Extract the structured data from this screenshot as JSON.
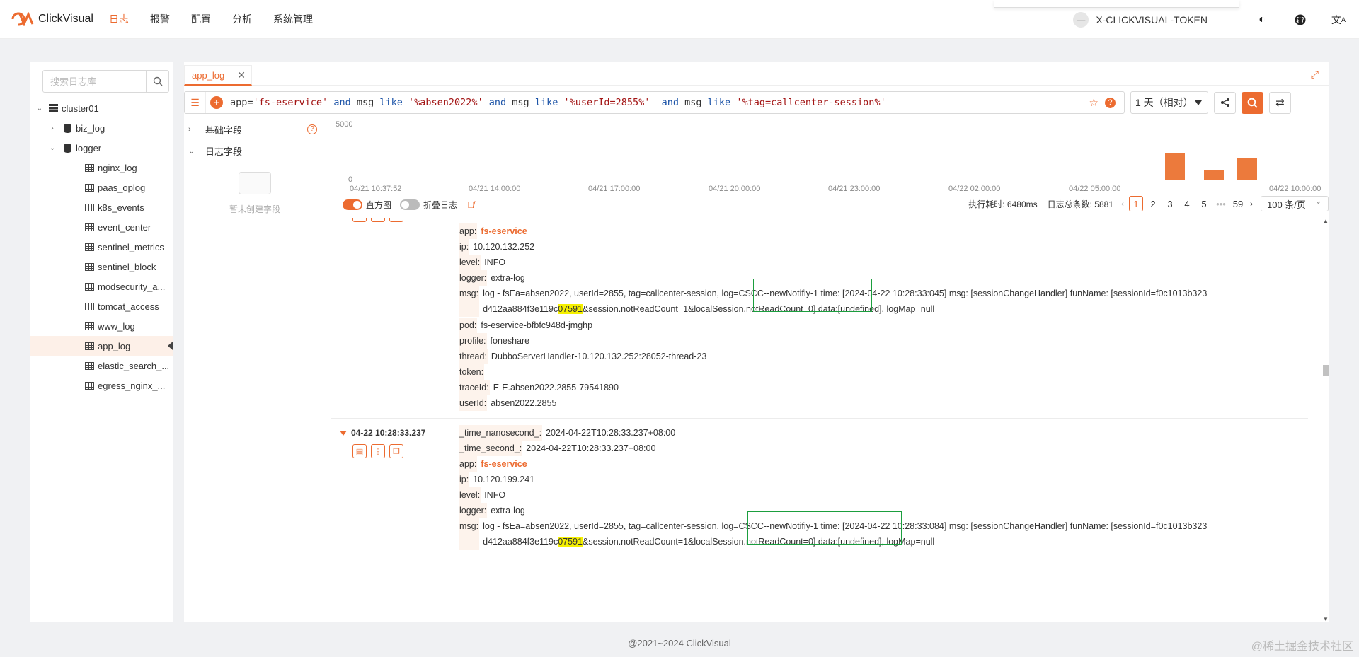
{
  "app": {
    "name": "ClickVisual"
  },
  "nav": [
    {
      "label": "日志",
      "active": true
    },
    {
      "label": "报警",
      "active": false
    },
    {
      "label": "配置",
      "active": false
    },
    {
      "label": "分析",
      "active": false
    },
    {
      "label": "系统管理",
      "active": false
    }
  ],
  "topright": {
    "token": "X-CLICKVISUAL-TOKEN",
    "icons": [
      "theme-icon",
      "github-icon",
      "translate-icon"
    ]
  },
  "sidebar": {
    "search_placeholder": "搜索日志库",
    "cluster": "cluster01",
    "databases": [
      {
        "name": "biz_log",
        "expanded": false
      },
      {
        "name": "logger",
        "expanded": true
      }
    ],
    "tables": [
      "nginx_log",
      "paas_oplog",
      "k8s_events",
      "event_center",
      "sentinel_metrics",
      "sentinel_block",
      "modsecurity_a...",
      "tomcat_access",
      "www_log",
      "app_log",
      "elastic_search_...",
      "egress_nginx_..."
    ],
    "selected_table": "app_log"
  },
  "tab": {
    "label": "app_log"
  },
  "query": {
    "time_range": "1 天（相对）",
    "parts": [
      {
        "t": "app=",
        "c": ""
      },
      {
        "t": "'fs-eservice'",
        "c": "s"
      },
      {
        "t": " and ",
        "c": "k"
      },
      {
        "t": "msg ",
        "c": ""
      },
      {
        "t": "like ",
        "c": "k"
      },
      {
        "t": "'%absen2022%'",
        "c": "s"
      },
      {
        "t": " and ",
        "c": "k"
      },
      {
        "t": "msg ",
        "c": ""
      },
      {
        "t": "like ",
        "c": "k"
      },
      {
        "t": "'%userId=2855%'",
        "c": "s"
      },
      {
        "t": "  and ",
        "c": "k"
      },
      {
        "t": "msg ",
        "c": ""
      },
      {
        "t": "like ",
        "c": "k"
      },
      {
        "t": "'%tag=callcenter-session%'",
        "c": "s"
      }
    ]
  },
  "fields": {
    "basic_label": "基础字段",
    "log_label": "日志字段",
    "empty_text": "暂未创建字段"
  },
  "histogram": {
    "y_ticks": [
      "5000",
      "0"
    ],
    "x_ticks": [
      "04/21 10:37:52",
      "04/21 14:00:00",
      "04/21 17:00:00",
      "04/21 20:00:00",
      "04/21 23:00:00",
      "04/22 02:00:00",
      "04/22 05:00:00",
      "04/22 10:00:00"
    ],
    "bars": [
      {
        "level": 0.48
      },
      {
        "level": 0.16
      },
      {
        "level": 0.38
      }
    ]
  },
  "toolbar": {
    "histogram_label": "直方图",
    "histogram_on": true,
    "fold_label": "折叠日志",
    "fold_on": false,
    "exec_time": "执行耗时: 6480ms",
    "total": "日志总条数: 5881",
    "pages": [
      "1",
      "2",
      "3",
      "4",
      "5",
      "•••",
      "59"
    ],
    "current_page": "1",
    "page_size": "100 条/页"
  },
  "logs": [
    {
      "fields": [
        {
          "k": "app:",
          "v": "fs-eservice",
          "orange": true
        },
        {
          "k": "ip:",
          "v": "10.120.132.252"
        },
        {
          "k": "level:",
          "v": "INFO"
        },
        {
          "k": "logger:",
          "v": "extra-log"
        },
        {
          "k": "msg:",
          "msg1": "log - fsEa=absen2022, userId=2855, tag=callcenter-session, log=CSCC--newNotifiy-1 time: [2024-04-22 10:28:33:045] msg: [sessionChangeHandler] funName: [sessionId=f0c1013b323",
          "msg2a": "d412aa884f3e119c",
          "msg2hl": "07591",
          "msg2b": "&session.notReadCount=1&localSession.notReadCount=0] data:[undefined], logMap=null"
        },
        {
          "k": "pod:",
          "v": "fs-eservice-bfbfc948d-jmghp"
        },
        {
          "k": "profile:",
          "v": "foneshare"
        },
        {
          "k": "thread:",
          "v": "DubboServerHandler-10.120.132.252:28052-thread-23"
        },
        {
          "k": "token:",
          "v": ""
        },
        {
          "k": "traceId:",
          "v": "E-E.absen2022.2855-79541890"
        },
        {
          "k": "userId:",
          "v": "absen2022.2855"
        }
      ]
    },
    {
      "time": "04-22 10:28:33.237",
      "fields": [
        {
          "k": "_time_nanosecond_:",
          "v": "2024-04-22T10:28:33.237+08:00"
        },
        {
          "k": "_time_second_:",
          "v": "2024-04-22T10:28:33.237+08:00"
        },
        {
          "k": "app:",
          "v": "fs-eservice",
          "orange": true
        },
        {
          "k": "ip:",
          "v": "10.120.199.241"
        },
        {
          "k": "level:",
          "v": "INFO"
        },
        {
          "k": "logger:",
          "v": "extra-log"
        },
        {
          "k": "msg:",
          "msg1": "log - fsEa=absen2022, userId=2855, tag=callcenter-session, log=CSCC--newNotifiy-1 time: [2024-04-22 10:28:33:084] msg: [sessionChangeHandler] funName: [sessionId=f0c1013b323",
          "msg2a": "d412aa884f3e119c",
          "msg2hl": "07591",
          "msg2b": "&session.notReadCount=1&localSession.notReadCount=0] data:[undefined], logMap=null"
        }
      ]
    }
  ],
  "footer": "@2021~2024 ClickVisual",
  "watermark": "@稀土掘金技术社区",
  "colors": {
    "accent": "#ec6b30",
    "highlight": "#f5f000",
    "annotation": "#1b9e3e"
  }
}
